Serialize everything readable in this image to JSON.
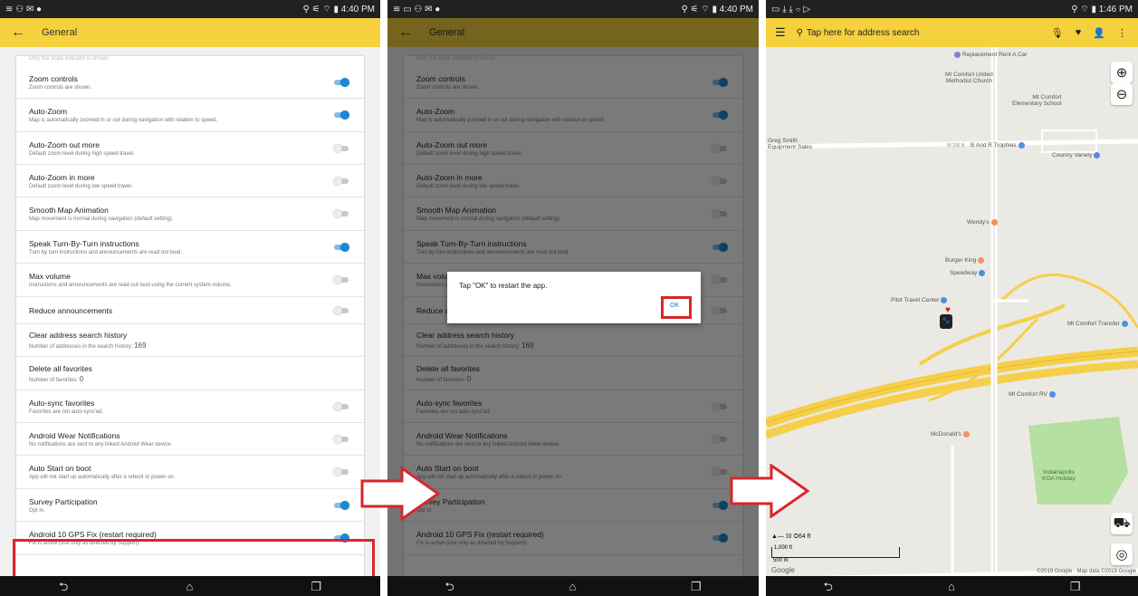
{
  "panel1": {
    "status": {
      "left": "≋ ⚇ ✉ ●",
      "right": "⚲ ⚟ ⌔ ▮ 4:40 PM"
    },
    "header_title": "General",
    "cut_text": "Only the scale indicator is shown.",
    "items": [
      {
        "title": "Zoom controls",
        "desc": "Zoom controls are shown.",
        "toggle": true
      },
      {
        "title": "Auto-Zoom",
        "desc": "Map is automatically zoomed in or out during navigation with relation to speed.",
        "toggle": true
      },
      {
        "title": "Auto-Zoom out more",
        "desc": "Default zoom level during high speed travel.",
        "toggle": false
      },
      {
        "title": "Auto-Zoom in more",
        "desc": "Default zoom level during low speed travel.",
        "toggle": false
      },
      {
        "title": "Smooth Map Animation",
        "desc": "Map movement is normal during navigation (default setting).",
        "toggle": false
      },
      {
        "title": "Speak Turn-By-Turn instructions",
        "desc": "Turn by turn instructions and announcements are read out loud.",
        "toggle": true
      },
      {
        "title": "Max volume",
        "desc": "Instructions and announcements are read out loud using the current system volume.",
        "toggle": false
      },
      {
        "title": "Reduce announcements",
        "desc": "",
        "toggle": false
      },
      {
        "title": "Clear address search history",
        "desc": "Number of addresses in the search history:",
        "count": "169",
        "toggle": null
      },
      {
        "title": "Delete all favorites",
        "desc": "Number of favorites:",
        "count": "0",
        "toggle": null
      },
      {
        "title": "Auto-sync favorites",
        "desc": "Favorites are not auto-sync'ed.",
        "toggle": false
      },
      {
        "title": "Android Wear Notifications",
        "desc": "No notifications are sent to any linked Android Wear device.",
        "toggle": false
      },
      {
        "title": "Auto Start on boot",
        "desc": "App will not start up automatically after a reboot or power on.",
        "toggle": false
      },
      {
        "title": "Survey Participation",
        "desc": "Opt in.",
        "toggle": true
      },
      {
        "title": "Android 10 GPS Fix (restart required)",
        "desc": "Fix is active (use only as directed by Support).",
        "toggle": true
      }
    ]
  },
  "panel2": {
    "status": {
      "left": "≋ ▭ ⚇ ✉ ●",
      "right": "⚲ ⚟ ⌔ ▮ 4:40 PM"
    },
    "dialog_message": "Tap \"OK\" to restart the app.",
    "dialog_ok": "OK"
  },
  "panel3": {
    "status": {
      "left": "▭ ⤓ ⤓ ⌔ ▷",
      "right": "⚲ ⌔ ▮ 1:46 PM"
    },
    "search_placeholder": "Tap here for address search",
    "labels": {
      "replacement": "Replacement Rent A Car",
      "church": "Mt Comfort United\nMethodist Church",
      "school": "Mt Comfort\nElementary School",
      "greg": "Greg Smith\nEquipment Sales",
      "trophies": "B And R Trophies",
      "variety": "Country Variety",
      "wendys": "Wendy's",
      "burgerking": "Burger King",
      "speedway": "Speedway",
      "pilot": "Pilot Travel Center",
      "transfer": "Mt Comfort Transfer",
      "rv": "Mt Comfort RV",
      "mcdonalds": "McDonald's",
      "koa": "Indianapolis\nKOA Holiday",
      "rd": "W 200 N"
    },
    "bottom_stats": "▲— ⟟0 ◎64 ft",
    "scale_ft": "1,000 ft",
    "scale_m": "500 m",
    "google": "Google",
    "copyright": "©2019 Google · Map data ©2019 Google"
  },
  "colors": {
    "accent": "#f4d13d",
    "highlight": "#d8262a",
    "toggle_on": "#1a88d6"
  }
}
